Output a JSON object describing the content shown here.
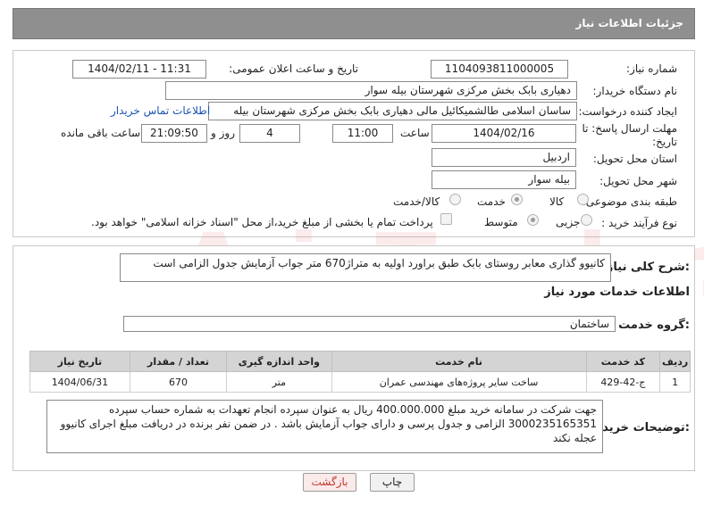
{
  "header": {
    "title": "جزئیات اطلاعات نیاز"
  },
  "form": {
    "need_number": {
      "label": "شماره نیاز:",
      "value": "1104093811000005"
    },
    "announce_datetime": {
      "label": "تاریخ و ساعت اعلان عمومی:",
      "value": "1404/02/11 - 11:31"
    },
    "buyer_org": {
      "label": "نام دستگاه خریدار:",
      "value": "دهیاری بابک بخش مرکزی شهرستان بیله سوار"
    },
    "requester": {
      "label": "ایجاد کننده درخواست:",
      "value": "ساسان اسلامی طالشمیکائیل مالی دهیاری بابک بخش مرکزی شهرستان بیله",
      "contact_link": "اطلاعات تماس خریدار"
    },
    "deadline": {
      "label": "مهلت ارسال پاسخ: تا تاریخ:",
      "date": "1404/02/16",
      "time_label": "ساعت",
      "time": "11:00",
      "days": "4",
      "days_label": "روز و",
      "remaining": "21:09:50",
      "remaining_label": "ساعت باقی مانده"
    },
    "province": {
      "label": "استان محل تحویل:",
      "value": "اردبیل"
    },
    "city": {
      "label": "شهر محل تحویل:",
      "value": "بیله سوار"
    },
    "category": {
      "label": "طبقه بندی موضوعی:",
      "options": [
        "کالا",
        "خدمت",
        "کالا/خدمت"
      ],
      "selected": "خدمت"
    },
    "purchase_type": {
      "label": "نوع فرآیند خرید :",
      "options": [
        "جزیی",
        "متوسط"
      ],
      "selected": "متوسط",
      "payment_text": "پرداخت تمام یا بخشی از مبلغ خرید،از محل \"اسناد خزانه اسلامی\" خواهد بود."
    }
  },
  "description": {
    "label": "شرح کلی نیاز:",
    "value": "کانیوو گذاری معابر روستای بابک طبق براورد اولیه به متراژ670 متر جواب آزمایش جدول الزامی است"
  },
  "services": {
    "title": "اطلاعات خدمات مورد نیاز",
    "group_label": "گروه خدمت:",
    "group_value": "ساختمان",
    "columns": [
      "ردیف",
      "کد خدمت",
      "نام خدمت",
      "واحد اندازه گیری",
      "تعداد / مقدار",
      "تاریخ نیاز"
    ],
    "rows": [
      [
        "1",
        "ج-42-429",
        "ساخت سایر پروژه‌های مهندسی عمران",
        "متر",
        "670",
        "1404/06/31"
      ]
    ]
  },
  "buyer_notes": {
    "label": "توضیحات خریدار:",
    "value": "جهت شرکت در سامانه خرید مبلغ 400.000.000 ریال به عنوان سپرده انجام تعهدات به شماره حساب سپرده 3000235165351 الزامی و جدول پرسی و دارای جواب آزمایش باشد . در ضمن نفر برنده در دریافت مبلغ اجرای کانیوو عجله نکند"
  },
  "buttons": {
    "print": "چاپ",
    "back": "بازگشت"
  },
  "watermark": "AriaTender.neT"
}
